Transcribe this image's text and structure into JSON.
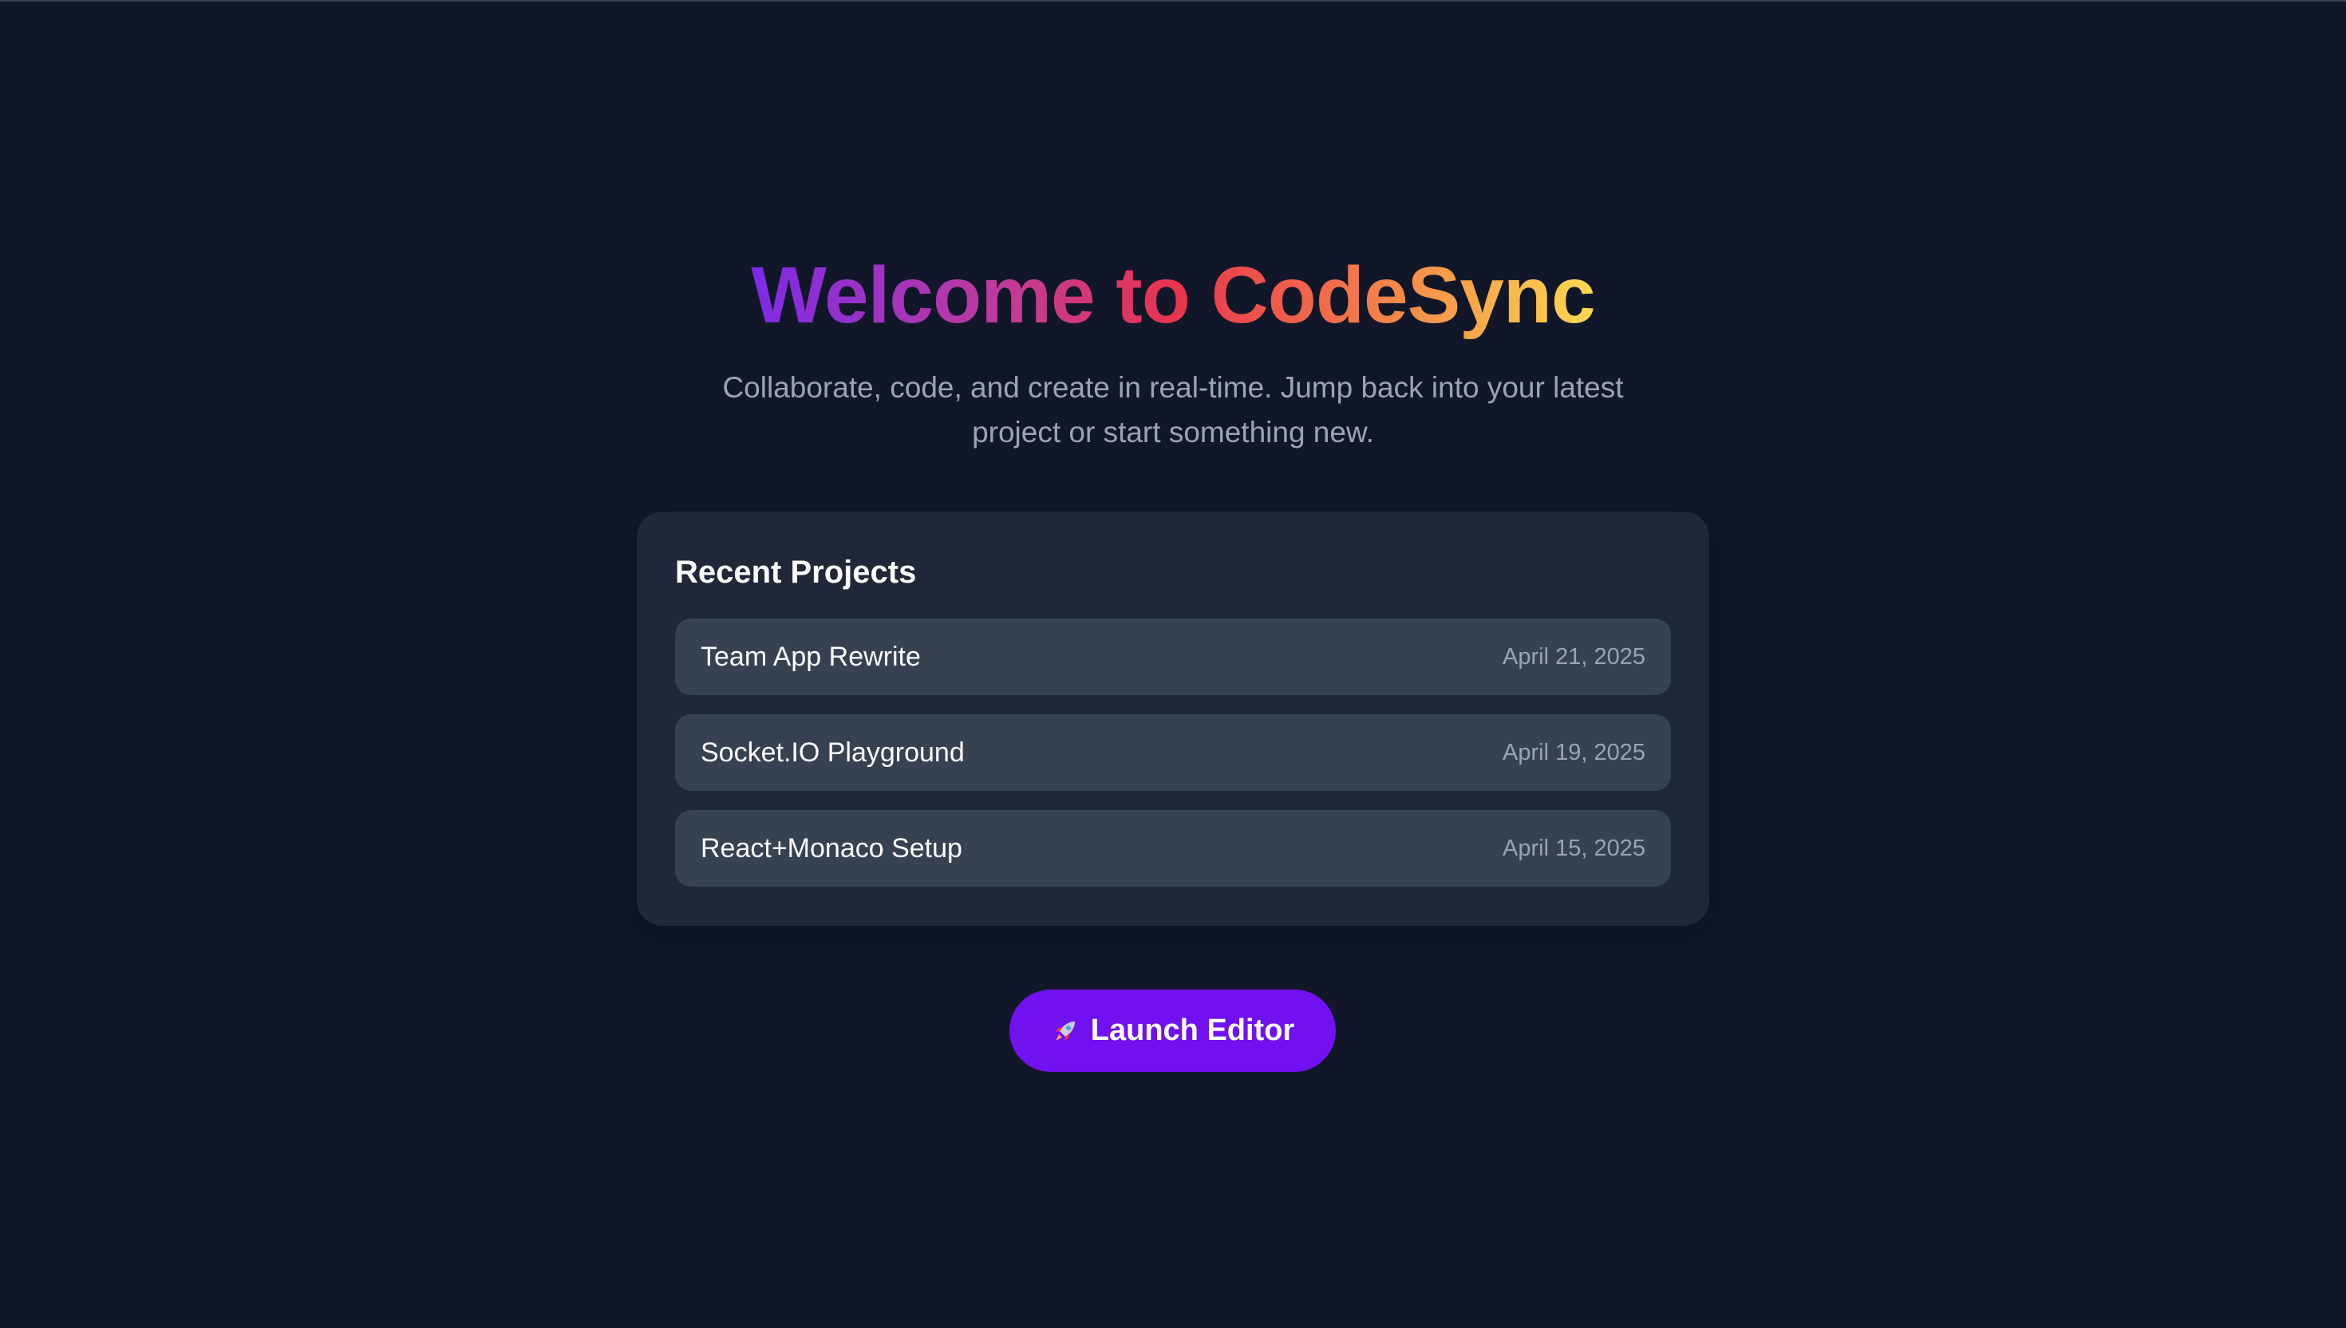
{
  "hero": {
    "title": "Welcome to CodeSync",
    "subtitle": "Collaborate, code, and create in real-time. Jump back into your latest project or start something new."
  },
  "recent": {
    "heading": "Recent Projects",
    "projects": [
      {
        "name": "Team App Rewrite",
        "date": "April 21, 2025"
      },
      {
        "name": "Socket.IO Playground",
        "date": "April 19, 2025"
      },
      {
        "name": "React+Monaco Setup",
        "date": "April 15, 2025"
      }
    ]
  },
  "launch": {
    "label": "Launch Editor",
    "icon": "rocket-icon"
  },
  "colors": {
    "background": "#111729",
    "card": "#1f2738",
    "row": "#364152",
    "accent": "#7211f0",
    "title_gradient": [
      "#7c2ae8",
      "#e8344e",
      "#fcd94f"
    ]
  }
}
